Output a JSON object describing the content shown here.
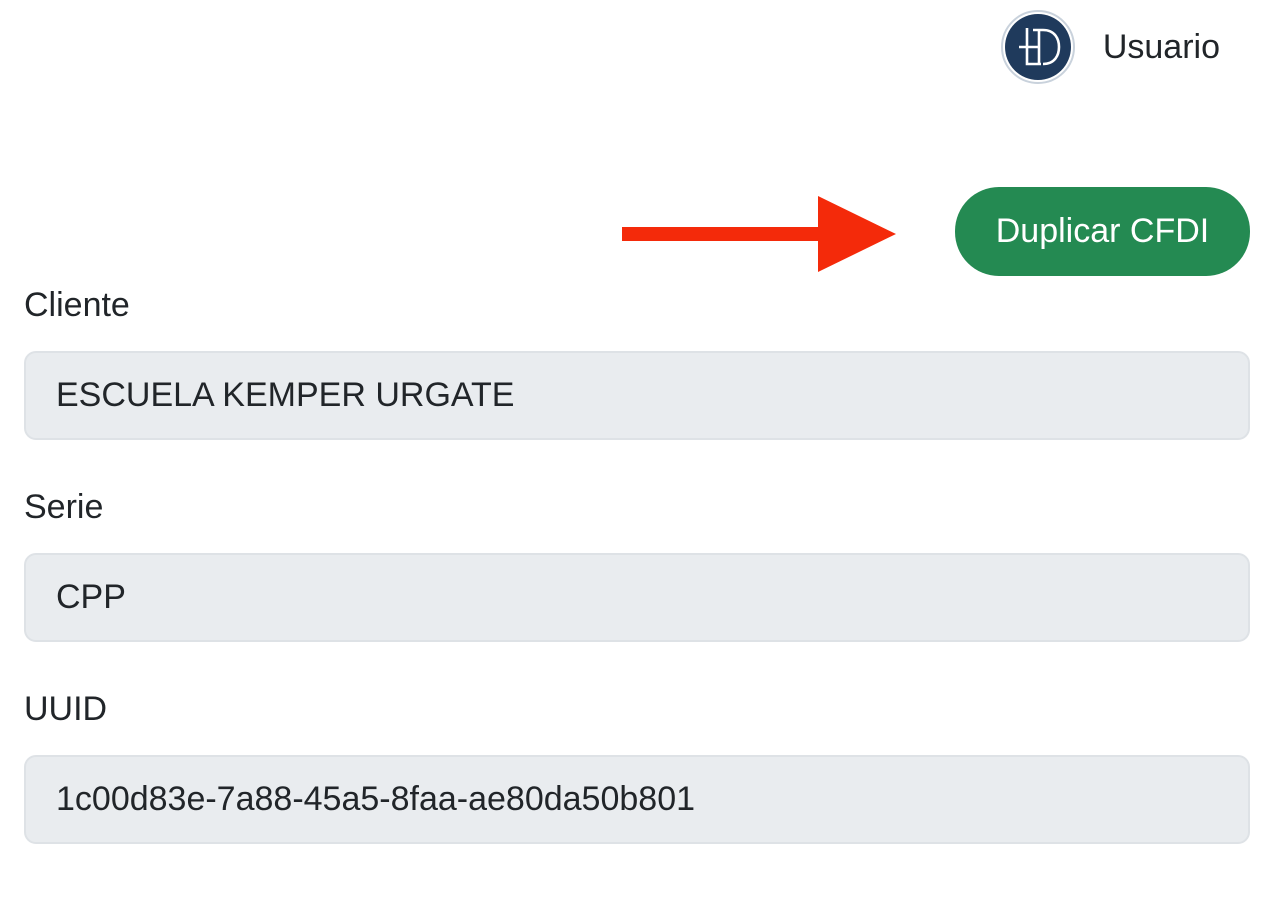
{
  "header": {
    "user_label": "Usuario",
    "avatar_icon": "ld-logo-icon"
  },
  "annotation": {
    "arrow_icon": "arrow-right-icon",
    "arrow_color": "#f42a0a"
  },
  "actions": {
    "duplicate_label": "Duplicar CFDI",
    "duplicate_color": "#248a52"
  },
  "form": {
    "cliente": {
      "label": "Cliente",
      "value": "ESCUELA KEMPER URGATE"
    },
    "serie": {
      "label": "Serie",
      "value": "CPP"
    },
    "uuid": {
      "label": "UUID",
      "value": "1c00d83e-7a88-45a5-8faa-ae80da50b801"
    }
  }
}
